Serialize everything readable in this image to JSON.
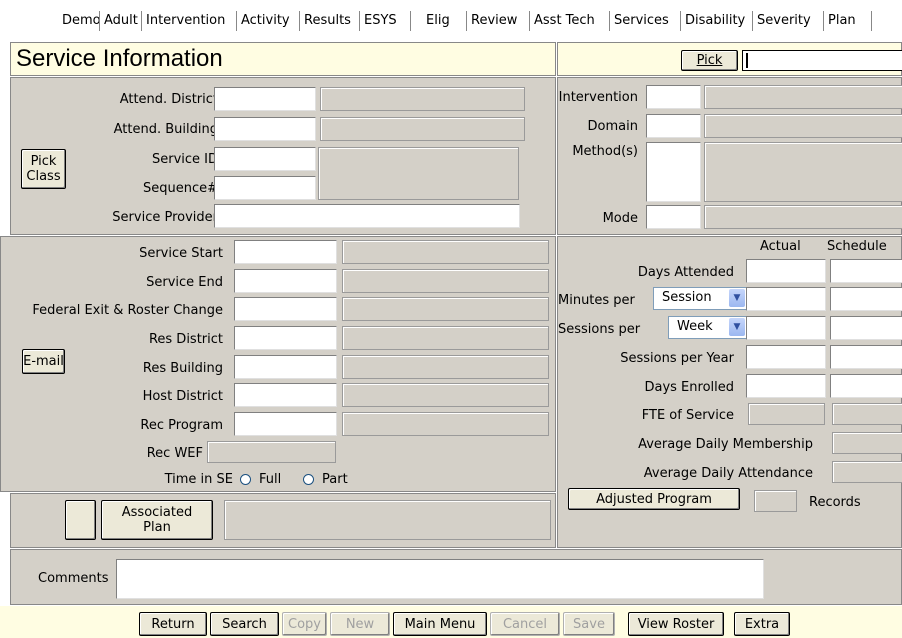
{
  "tabs": [
    "Demo",
    "Adult",
    "Intervention",
    "Activity",
    "Results",
    "ESYS",
    "Elig",
    "Review",
    "Asst Tech",
    "Services",
    "Disability",
    "Severity",
    "Plan"
  ],
  "header": {
    "title": "Service Information",
    "pick_label": "Pick",
    "pick_value": ""
  },
  "left_top": {
    "pick_class_label": "Pick\nClass",
    "attend_district": "Attend. District",
    "attend_building": "Attend. Building",
    "service_id": "Service ID",
    "sequence": "Sequence#",
    "service_provider": "Service Provider"
  },
  "right_top": {
    "intervention": "Intervention",
    "domain": "Domain",
    "methods": "Method(s)",
    "mode": "Mode"
  },
  "left_mid": {
    "service_start": "Service Start",
    "service_end": "Service End",
    "federal_exit": "Federal Exit & Roster Change",
    "res_district": "Res District",
    "res_building": "Res Building",
    "host_district": "Host District",
    "rec_program": "Rec Program",
    "rec_wef": "Rec WEF",
    "time_in_se": "Time in SE",
    "full": "Full",
    "part": "Part",
    "email_label": "E-mail"
  },
  "right_mid": {
    "actual": "Actual",
    "schedule": "Schedule",
    "days_attended": "Days Attended",
    "minutes_per": "Minutes per",
    "minutes_per_select": "Session",
    "sessions_per": "Sessions per",
    "sessions_per_select": "Week",
    "sessions_per_year": "Sessions per Year",
    "days_enrolled": "Days Enrolled",
    "fte_of_service": "FTE of Service",
    "avg_daily_membership": "Average Daily Membership",
    "avg_daily_attendance": "Average Daily Attendance",
    "adjusted_program": "Adjusted Program",
    "records": "Records"
  },
  "assoc": {
    "associated_plan": "Associated\nPlan"
  },
  "comments": {
    "label": "Comments"
  },
  "toolbar": {
    "return": "Return",
    "search": "Search",
    "copy": "Copy",
    "new": "New",
    "main_menu": "Main Menu",
    "cancel": "Cancel",
    "save": "Save",
    "view_roster": "View Roster",
    "extra": "Extra"
  }
}
